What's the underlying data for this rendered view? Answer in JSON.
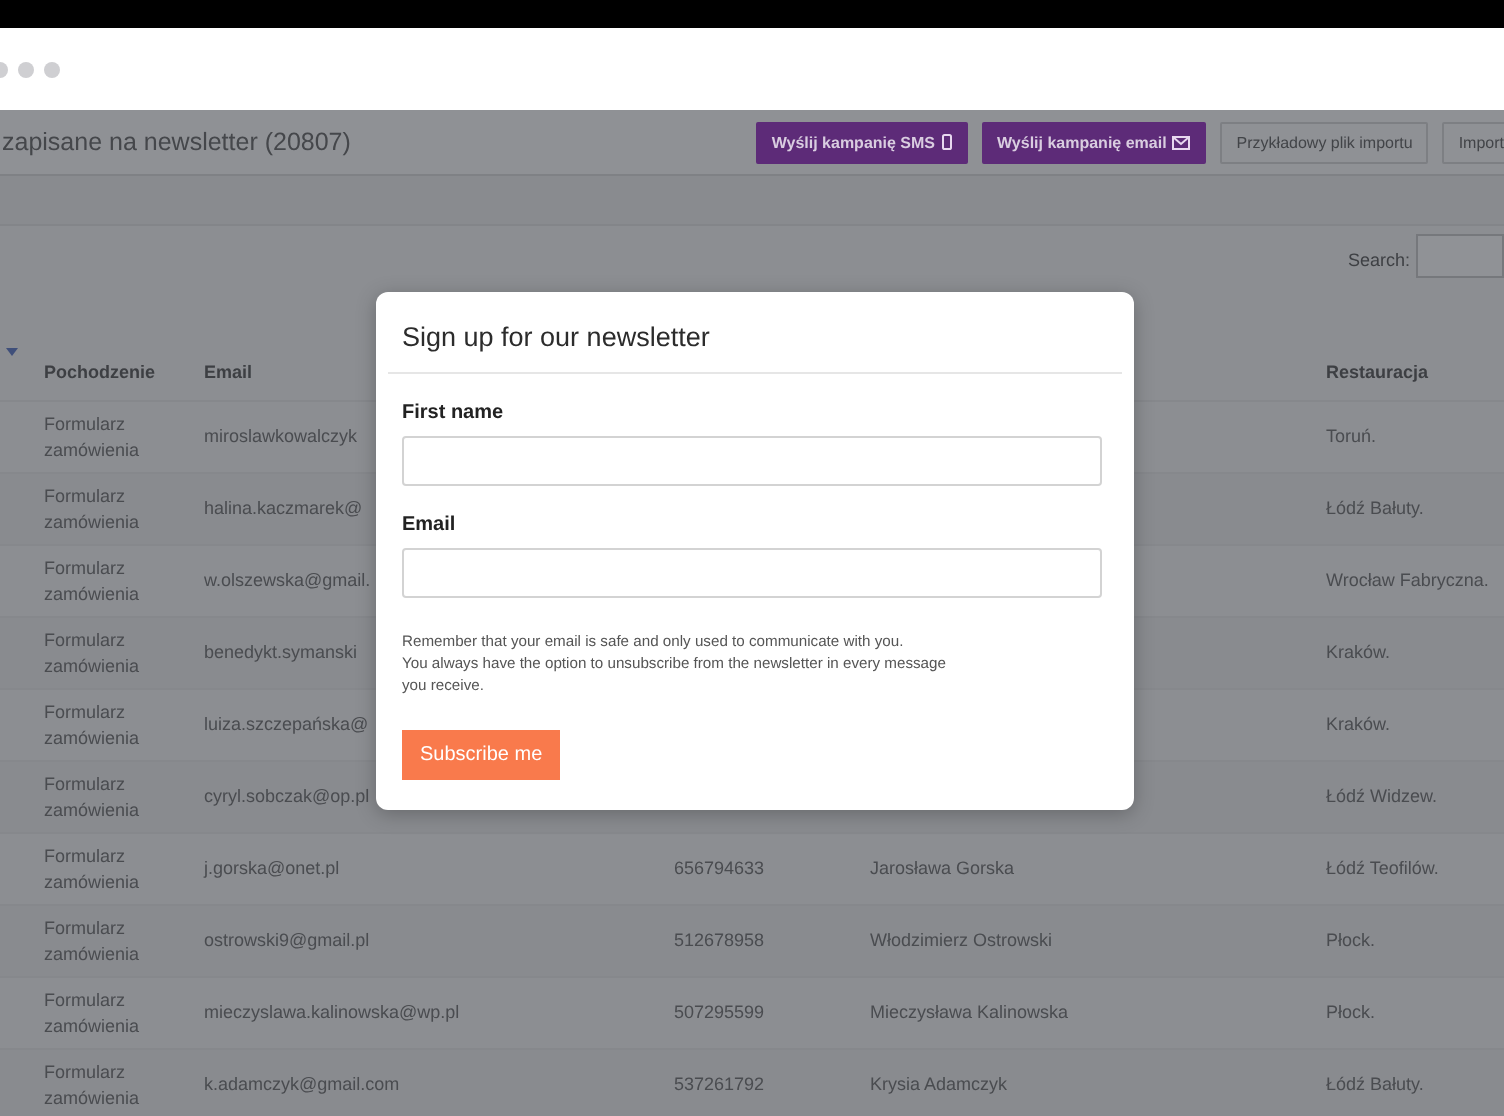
{
  "header": {
    "title": "zapisane na newsletter (20807)",
    "buttons": [
      {
        "label": "Wyślij kampanię SMS",
        "kind": "sms"
      },
      {
        "label": "Wyślij kampanię email",
        "kind": "email"
      },
      {
        "label": "Przykładowy plik importu",
        "kind": "outline"
      },
      {
        "label": "Import",
        "kind": "outline"
      }
    ]
  },
  "search": {
    "label": "Search:"
  },
  "table": {
    "columns": {
      "origin": "Pochodzenie",
      "email": "Email",
      "restaurant": "Restauracja"
    },
    "rows": [
      {
        "origin": "Formularz zamówienia",
        "email": "miroslawkowalczyk",
        "restaurant": "Toruń."
      },
      {
        "origin": "Formularz zamówienia",
        "email": "halina.kaczmarek@",
        "restaurant": "Łódź Bałuty."
      },
      {
        "origin": "Formularz zamówienia",
        "email": "w.olszewska@gmail.",
        "restaurant": "Wrocław Fabryczna."
      },
      {
        "origin": "Formularz zamówienia",
        "email": "benedykt.symanski",
        "restaurant": "Kraków."
      },
      {
        "origin": "Formularz zamówienia",
        "email": "luiza.szczepańska@",
        "restaurant": "Kraków."
      },
      {
        "origin": "Formularz zamówienia",
        "email": "cyryl.sobczak@op.pl",
        "restaurant": "Łódź Widzew."
      },
      {
        "origin": "Formularz zamówienia",
        "email": "j.gorska@onet.pl",
        "phone": "656794633",
        "name": "Jarosława Gorska",
        "restaurant": "Łódź Teofilów."
      },
      {
        "origin": "Formularz zamówienia",
        "email": "ostrowski9@gmail.pl",
        "phone": "512678958",
        "name": "Włodzimierz Ostrowski",
        "restaurant": "Płock."
      },
      {
        "origin": "Formularz zamówienia",
        "email": "mieczyslawa.kalinowska@wp.pl",
        "phone": "507295599",
        "name": "Mieczysława Kalinowska",
        "restaurant": "Płock."
      },
      {
        "origin": "Formularz zamówienia",
        "email": "k.adamczyk@gmail.com",
        "phone": "537261792",
        "name": "Krysia Adamczyk",
        "restaurant": "Łódź Bałuty."
      }
    ]
  },
  "modal": {
    "title": "Sign up for our newsletter",
    "fields": [
      {
        "label": "First name"
      },
      {
        "label": "Email"
      }
    ],
    "note": "Remember that your email is safe and only used to communicate with you.\nYou always have the option to unsubscribe from the newsletter in every message\nyou receive.",
    "button": "Subscribe me"
  }
}
